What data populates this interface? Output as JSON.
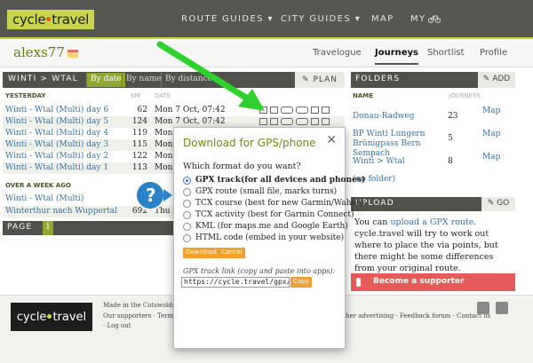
{
  "colors": {
    "accent": "#8fa82f",
    "logo": "#c9d64c",
    "dark_bar": "#4f514a",
    "link": "#36709f",
    "arrow": "#2fd12f",
    "button": "#f0a030",
    "supporter": "#e65a5a",
    "help": "#2b82c9"
  },
  "header": {
    "logo_left": "cycle",
    "logo_right": "travel",
    "nav": [
      "ROUTE GUIDES ▾",
      "CITY GUIDES ▾",
      "MAP",
      "MY"
    ]
  },
  "user": {
    "name": "alexs77"
  },
  "subnav": [
    "Travelogue",
    "Journeys",
    "Shortlist",
    "Profile"
  ],
  "journeys": {
    "title": "WINTI > WTAL",
    "sort": [
      "By date",
      "By name",
      "By distance"
    ],
    "plan": "PLAN",
    "section_yesterday": "YESTERDAY",
    "col_km": "KM",
    "col_date": "DATE",
    "rows": [
      {
        "name": "Winti - Wtal (Multi) day 6",
        "km": "62",
        "date": "Mon 7 Oct, 07:42"
      },
      {
        "name": "Winti - Wtal (Multi) day 5",
        "km": "124",
        "date": "Mon 7 Oct, 07:42"
      },
      {
        "name": "Winti - Wtal (Multi) day 4",
        "km": "119",
        "date": "Mon"
      },
      {
        "name": "Winti - Wtal (Multi) day 3",
        "km": "115",
        "date": "Mon"
      },
      {
        "name": "Winti - Wtal (Multi) day 2",
        "km": "122",
        "date": "Mon"
      },
      {
        "name": "Winti - Wtal (Multi) day 1",
        "km": "113",
        "date": "Mon"
      }
    ],
    "section_older": "OVER A WEEK AGO",
    "older_rows": [
      {
        "name": "Winti - Wtal (Multi)",
        "km": "",
        "date": ""
      },
      {
        "name": "Winterthur nach Wuppertal",
        "km": "692",
        "date": "Thu 1"
      }
    ],
    "page_label": "PAGE",
    "page_num": "1"
  },
  "folders": {
    "title": "FOLDERS",
    "add": "ADD",
    "col_name": "NAME",
    "col_journeys": "JOURNEYS",
    "items": [
      {
        "name": "Donau-Radweg",
        "count": "23",
        "map": "Map"
      },
      {
        "name": "BP Winti Lungern Brünigpass Bern Sempach",
        "count": "5",
        "map": "Map"
      },
      {
        "name": "Winti > Wtal",
        "count": "8",
        "map": "Map"
      }
    ],
    "no_folder": "(no folder)"
  },
  "upload": {
    "title": "UPLOAD",
    "go": "GO",
    "text_pre": "You can ",
    "link": "upload a GPX route",
    "text_post": ". cycle.travel will try to work out where to place the via points, but there might be some differences from your original route."
  },
  "supporter": {
    "label": "Become a supporter"
  },
  "footer": {
    "made": "Made in the Cotswolds. Pu",
    "links": "Our supporters · Terms of",
    "logout": "· Log out",
    "right_links": "her advertising · Feedback forum · Contact us"
  },
  "modal": {
    "title": "Download for GPS/phone",
    "close": "✕",
    "question": "Which format do you want?",
    "options": [
      {
        "bold": "GPX track",
        "rest": " (for all devices and phones)",
        "selected": true
      },
      {
        "bold": "",
        "rest": "GPX route (small file, marks turns)",
        "selected": false
      },
      {
        "bold": "",
        "rest": "TCX course (best for new Garmin/Wahoo)",
        "selected": false
      },
      {
        "bold": "",
        "rest": "TCX activity (best for Garmin Connect)",
        "selected": false
      },
      {
        "bold": "",
        "rest": "KML (for maps.me and Google Earth)",
        "selected": false
      },
      {
        "bold": "",
        "rest": "HTML code (embed in your website)",
        "selected": false
      }
    ],
    "download": "Download",
    "cancel": "Cancel",
    "link_label": "GPX track link (copy and paste into apps):",
    "link_value": "https://cycle.travel/gpx/",
    "copy": "Copy"
  },
  "help_badge": "?"
}
